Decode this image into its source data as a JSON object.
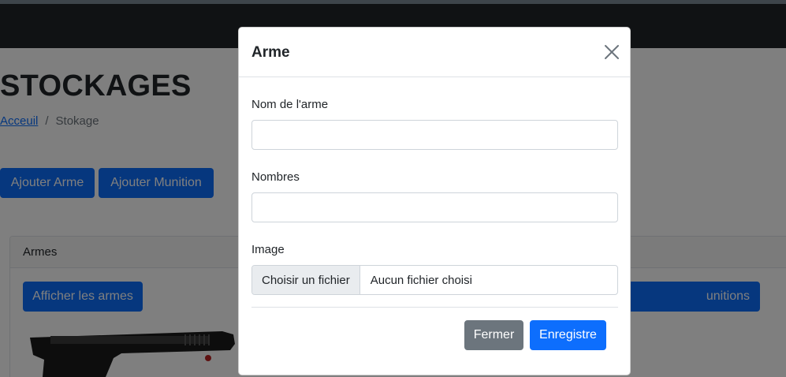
{
  "page": {
    "title": "STOCKAGES",
    "breadcrumb": {
      "home": "Acceuil",
      "separator": "/",
      "current": "Stokage"
    },
    "buttons": {
      "add_arme": "Ajouter Arme",
      "add_munition": "Ajouter Munition"
    },
    "card": {
      "header": "Armes",
      "show_button": "Afficher les armes",
      "munitions_button_partial": "unitions"
    }
  },
  "modal": {
    "title": "Arme",
    "fields": {
      "name_label": "Nom de l'arme",
      "name_value": "",
      "count_label": "Nombres",
      "count_value": "",
      "image_label": "Image",
      "file_button": "Choisir un fichier",
      "file_status": "Aucun fichier choisi"
    },
    "footer": {
      "close": "Fermer",
      "save": "Enregistre"
    }
  },
  "colors": {
    "primary": "#0d6efd",
    "secondary": "#6c757d",
    "navbar": "#212529"
  },
  "icons": {
    "close": "close-icon",
    "gun": "pistol-image"
  }
}
